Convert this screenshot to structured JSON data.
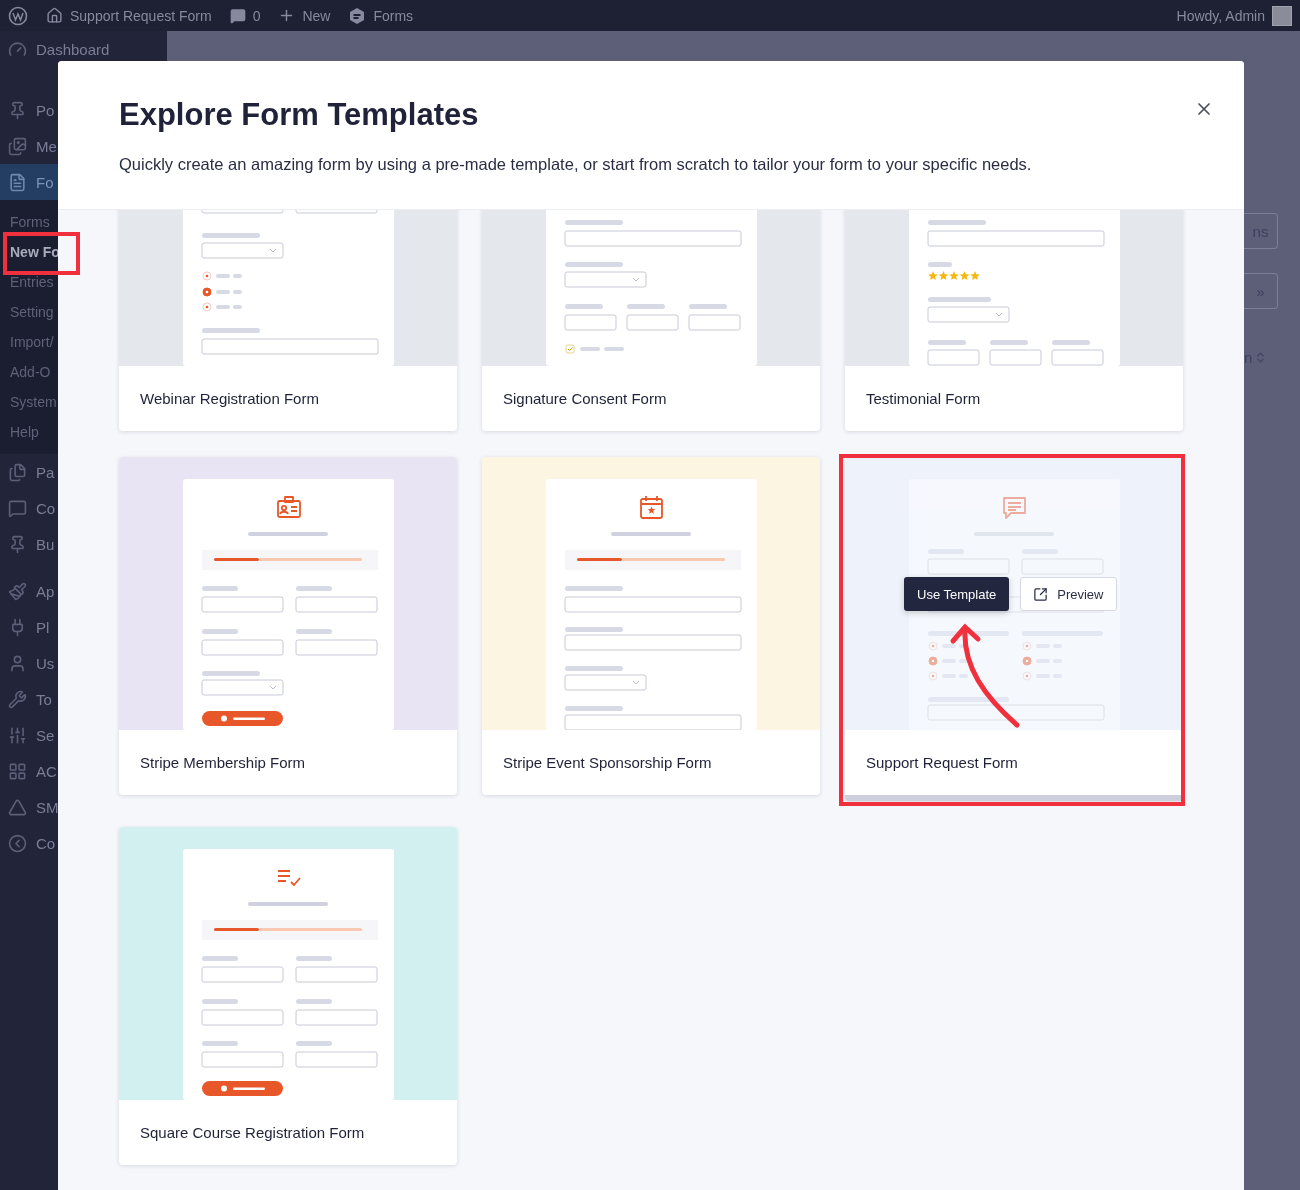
{
  "admin_bar": {
    "site": "Support Request Form",
    "comments": "0",
    "new": "New",
    "forms": "Forms",
    "greeting": "Howdy, Admin"
  },
  "sidebar": {
    "groups": [
      [
        {
          "label": "Dashboard",
          "selected": false
        }
      ],
      [
        {
          "label": "Po",
          "selected": false
        },
        {
          "label": "Me",
          "selected": false
        },
        {
          "label": "Fo",
          "selected": true,
          "children": [
            {
              "label": "Forms",
              "selected": false,
              "highlighted": false
            },
            {
              "label": "New Fo",
              "selected": true,
              "highlighted": true
            },
            {
              "label": "Entries",
              "selected": false,
              "highlighted": false
            },
            {
              "label": "Setting",
              "selected": false,
              "highlighted": false
            },
            {
              "label": "Import/",
              "selected": false,
              "highlighted": false
            },
            {
              "label": "Add-O",
              "selected": false,
              "highlighted": false
            },
            {
              "label": "System",
              "selected": false,
              "highlighted": false
            },
            {
              "label": "Help",
              "selected": false,
              "highlighted": false
            }
          ]
        },
        {
          "label": "Pa",
          "selected": false
        },
        {
          "label": "Co",
          "selected": false
        },
        {
          "label": "Bu",
          "selected": false
        }
      ],
      [
        {
          "label": "Ap",
          "selected": false
        },
        {
          "label": "Pl",
          "selected": false
        },
        {
          "label": "Us",
          "selected": false
        },
        {
          "label": "To",
          "selected": false
        },
        {
          "label": "Se",
          "selected": false
        },
        {
          "label": "AC",
          "selected": false
        },
        {
          "label": "SM",
          "selected": false
        },
        {
          "label": "Co",
          "selected": false
        }
      ]
    ]
  },
  "background_page": {
    "buttons": [
      "ns",
      "»"
    ],
    "column_label": "n"
  },
  "modal": {
    "title": "Explore Form Templates",
    "subtitle": "Quickly create an amazing form by using a pre-made template, or start from scratch to tailor your form to your specific needs.",
    "actions": {
      "use": "Use Template",
      "preview": "Preview"
    },
    "templates": [
      {
        "name": "Webinar Registration Form",
        "kind": "webinar",
        "color": "#e4e7eb",
        "hovered": false,
        "highlighted": false
      },
      {
        "name": "Signature Consent Form",
        "kind": "signature",
        "color": "#e4e7eb",
        "hovered": false,
        "highlighted": false
      },
      {
        "name": "Testimonial Form",
        "kind": "testimonial",
        "color": "#e4e7eb",
        "hovered": false,
        "highlighted": false
      },
      {
        "name": "Stripe Membership Form",
        "kind": "membership",
        "color": "#e8e4f3",
        "hovered": false,
        "highlighted": false
      },
      {
        "name": "Stripe Event Sponsorship Form",
        "kind": "sponsorship",
        "color": "#fcf5e2",
        "hovered": false,
        "highlighted": false
      },
      {
        "name": "Support Request Form",
        "kind": "support",
        "color": "#eef3fb",
        "hovered": true,
        "highlighted": true
      },
      {
        "name": "Square Course Registration Form",
        "kind": "course",
        "color": "#d3f0f0",
        "hovered": false,
        "highlighted": false
      }
    ]
  }
}
